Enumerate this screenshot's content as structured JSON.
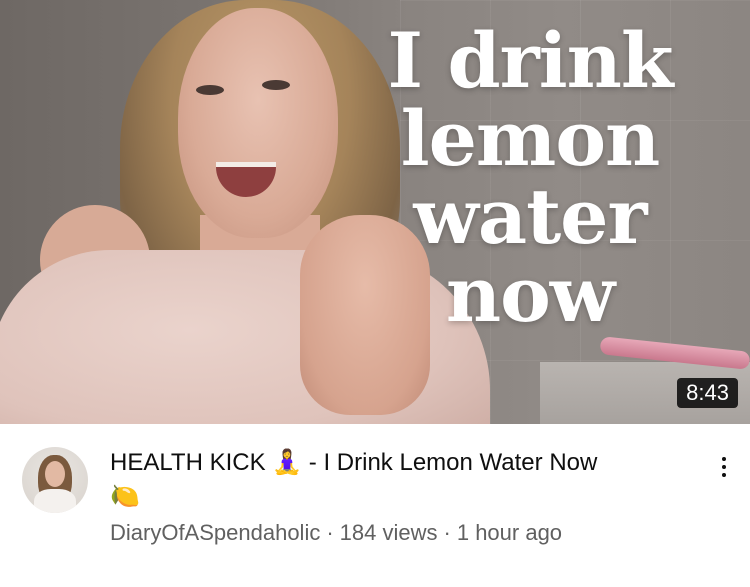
{
  "thumbnail": {
    "overlay_text": [
      "I drink",
      "lemon",
      "water",
      "now"
    ],
    "duration": "8:43"
  },
  "video": {
    "title": "HEALTH KICK 🧘‍♀️ - I Drink Lemon Water Now",
    "title_emoji_line2": "🍋",
    "channel": "DiaryOfASpendaholic",
    "separator": "·",
    "views": "184 views",
    "age": "1 hour ago"
  },
  "icons": {
    "more": "more-vert-icon",
    "avatar": "channel-avatar"
  },
  "colors": {
    "title": "#0f0f0f",
    "meta": "#606060",
    "duration_bg": "#000000"
  }
}
